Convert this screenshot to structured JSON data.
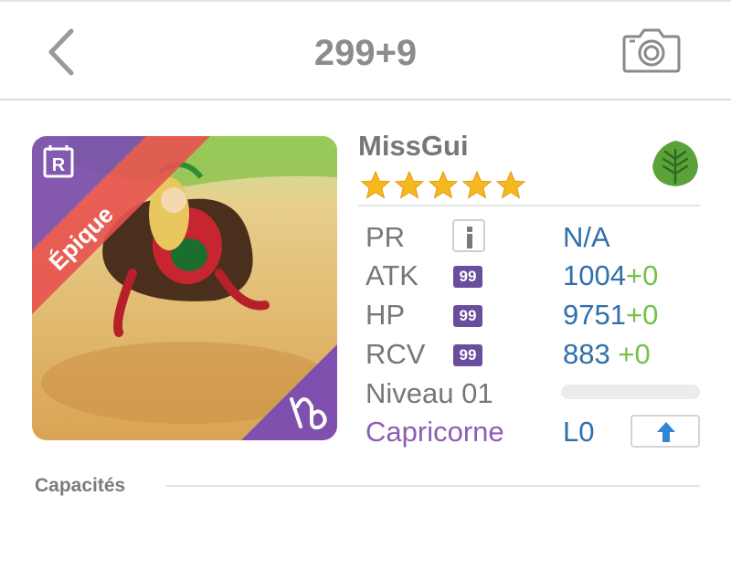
{
  "nav": {
    "title": "299+9",
    "back_icon": "chevron-left-icon",
    "camera_icon": "camera-icon"
  },
  "card": {
    "rarity_label": "Épique",
    "rarity_color": "#e8524f",
    "class_color": "#7a4bb3",
    "r_badge": "R",
    "zodiac_icon": "capricorn-icon"
  },
  "monster": {
    "name": "MissGui",
    "stars": 5,
    "element_icon": "leaf-icon",
    "element_color": "#5ba23a"
  },
  "stats": [
    {
      "label": "PR",
      "badge": "",
      "value": "N/A",
      "plus": ""
    },
    {
      "label": "ATK",
      "badge": "99",
      "value": "1004",
      "plus": "+0"
    },
    {
      "label": "HP",
      "badge": "99",
      "value": "9751",
      "plus": "+0"
    },
    {
      "label": "RCV",
      "badge": "99",
      "value": "883 ",
      "plus": "+0"
    }
  ],
  "level": {
    "label": "Niveau 01",
    "progress": 0.0
  },
  "zodiac": {
    "label": "Capricorne",
    "value": "L0",
    "upgrade_icon": "arrow-up-icon"
  },
  "section": {
    "title": "Capacités"
  }
}
